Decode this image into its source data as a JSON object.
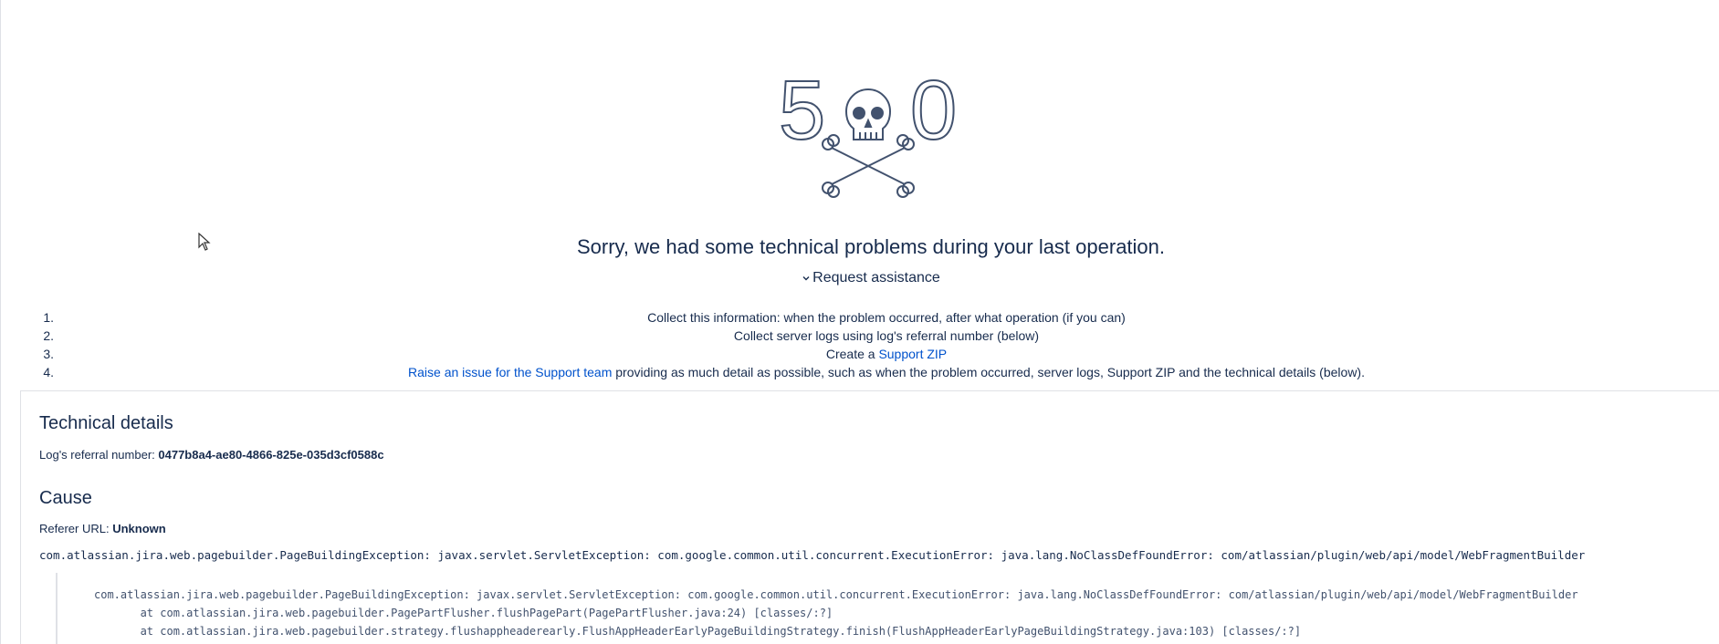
{
  "error": {
    "code_left": "5",
    "code_right": "0",
    "headline": "Sorry, we had some technical problems during your last operation.",
    "assist_label": "Request assistance"
  },
  "steps": [
    {
      "num": "1.",
      "text": "Collect this information: when the problem occurred, after what operation (if you can)"
    },
    {
      "num": "2.",
      "text": "Collect server logs using log's referral number (below)"
    },
    {
      "num": "3.",
      "prefix": "Create a ",
      "link": "Support ZIP"
    },
    {
      "num": "4.",
      "link": "Raise an issue for the Support team",
      "suffix": " providing as much detail as possible, such as when the problem occurred, server logs, Support ZIP and the technical details (below)."
    }
  ],
  "technical": {
    "title": "Technical details",
    "ref_label": "Log's referral number: ",
    "ref_value": "0477b8a4-ae80-4866-825e-035d3cf0588c",
    "cause_title": "Cause",
    "referer_label": "Referer URL: ",
    "referer_value": "Unknown",
    "exception": "com.atlassian.jira.web.pagebuilder.PageBuildingException: javax.servlet.ServletException: com.google.common.util.concurrent.ExecutionError: java.lang.NoClassDefFoundError: com/atlassian/plugin/web/api/model/WebFragmentBuilder",
    "stack": [
      "com.atlassian.jira.web.pagebuilder.PageBuildingException: javax.servlet.ServletException: com.google.common.util.concurrent.ExecutionError: java.lang.NoClassDefFoundError: com/atlassian/plugin/web/api/model/WebFragmentBuilder",
      "\tat com.atlassian.jira.web.pagebuilder.PagePartFlusher.flushPagePart(PagePartFlusher.java:24) [classes/:?]",
      "\tat com.atlassian.jira.web.pagebuilder.strategy.flushappheaderearly.FlushAppHeaderEarlyPageBuildingStrategy.finish(FlushAppHeaderEarlyPageBuildingStrategy.java:103) [classes/:?]"
    ]
  },
  "colors": {
    "text": "#172b4d",
    "link": "#0052cc",
    "border": "#dfe1e6"
  }
}
